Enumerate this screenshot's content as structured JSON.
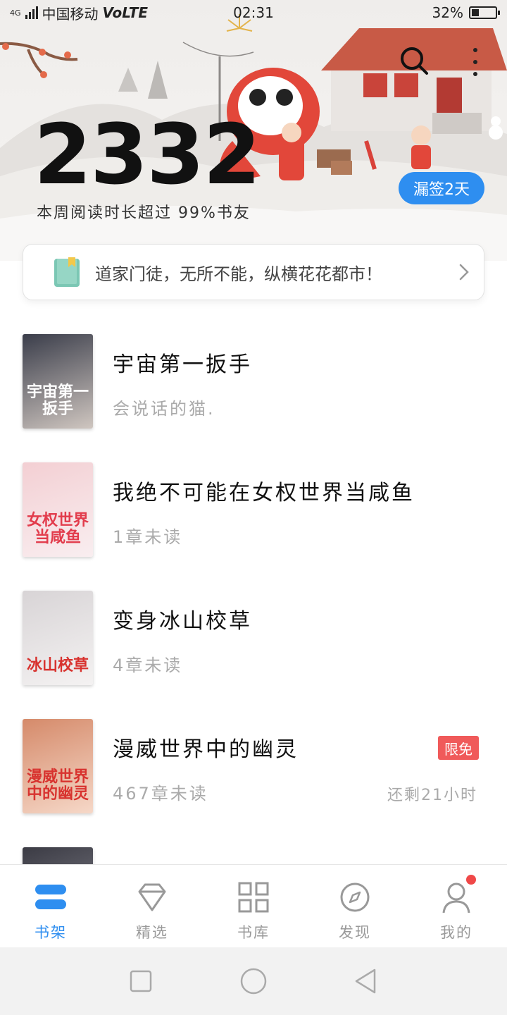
{
  "status_bar": {
    "network": "4G",
    "carrier": "中国移动",
    "volte": "VoLTE",
    "time": "02:31",
    "battery_pct_text": "32%",
    "battery_level": 0.32
  },
  "header": {
    "reading_minutes": "2332",
    "subtitle": "本周阅读时长超过 99%书友",
    "streak_button": "漏签2天"
  },
  "recommendation": {
    "text": "道家门徒，无所不能，纵横花花都市！"
  },
  "books": [
    {
      "title": "宇宙第一扳手",
      "subtitle": "会说话的猫.",
      "cover_text": "宇宙第一扳手",
      "cover_colors": [
        "#3a3d4a",
        "#cfc6c0"
      ]
    },
    {
      "title": "我绝不可能在女权世界当咸鱼",
      "subtitle": "1章未读",
      "cover_text": "女权世界当咸鱼",
      "cover_colors": [
        "#f3cfd3",
        "#f9eef0"
      ]
    },
    {
      "title": "变身冰山校草",
      "subtitle": "4章未读",
      "cover_text": "冰山校草",
      "cover_colors": [
        "#d8d4d6",
        "#f4f2f2"
      ]
    },
    {
      "title": "漫威世界中的幽灵",
      "subtitle": "467章未读",
      "badge": "限免",
      "time_left": "还剩21小时",
      "cover_text": "漫威世界中的幽灵",
      "cover_colors": [
        "#d58a6a",
        "#f6d8c8"
      ]
    },
    {
      "title": "",
      "subtitle": "",
      "cover_text": "",
      "cover_colors": [
        "#3b3b44",
        "#8c8c96"
      ]
    }
  ],
  "bottom_nav": [
    {
      "label": "书架",
      "icon": "bookshelf-icon",
      "active": true
    },
    {
      "label": "精选",
      "icon": "diamond-icon",
      "active": false
    },
    {
      "label": "书库",
      "icon": "grid-icon",
      "active": false
    },
    {
      "label": "发现",
      "icon": "compass-icon",
      "active": false
    },
    {
      "label": "我的",
      "icon": "person-icon",
      "active": false
    }
  ],
  "colors": {
    "accent": "#2e8ef0",
    "badge_red": "#f05a5a",
    "notification_dot": "#f04848"
  }
}
